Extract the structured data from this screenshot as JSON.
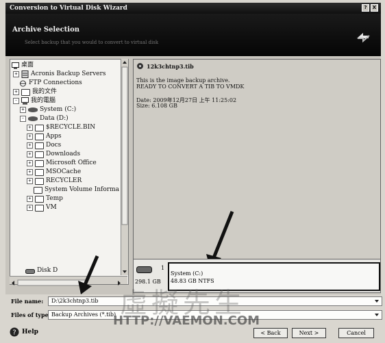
{
  "window": {
    "title": "Conversion to Virtual Disk Wizard",
    "controls": [
      "?",
      "X"
    ]
  },
  "header": {
    "title": "Archive Selection",
    "subtitle": "Select backup that you would to convert to virtual disk"
  },
  "tree": {
    "items": [
      {
        "label": "桌面",
        "icon": "desktop-icon",
        "expander": ""
      },
      {
        "label": "Acronis Backup Servers",
        "icon": "server-icon",
        "expander": "+"
      },
      {
        "label": "FTP Connections",
        "icon": "ftp-icon",
        "expander": ""
      },
      {
        "label": "我的文件",
        "icon": "folder-icon",
        "expander": "+"
      },
      {
        "label": "我的電腦",
        "icon": "computer-icon",
        "expander": "-"
      },
      {
        "label": "System (C:)",
        "icon": "drive-icon",
        "expander": "+"
      },
      {
        "label": "Data (D:)",
        "icon": "drive-icon",
        "expander": "-"
      },
      {
        "label": "$RECYCLE.BIN",
        "icon": "folder-icon",
        "expander": "+"
      },
      {
        "label": "Apps",
        "icon": "folder-icon",
        "expander": "+"
      },
      {
        "label": "Docs",
        "icon": "folder-icon",
        "expander": "+"
      },
      {
        "label": "Downloads",
        "icon": "folder-icon",
        "expander": "+"
      },
      {
        "label": "Microsoft Office",
        "icon": "folder-icon",
        "expander": "+"
      },
      {
        "label": "MSOCache",
        "icon": "folder-icon",
        "expander": "+"
      },
      {
        "label": "RECYCLER",
        "icon": "folder-icon",
        "expander": "+"
      },
      {
        "label": "System Volume Informa",
        "icon": "folder-icon",
        "expander": ""
      },
      {
        "label": "Temp",
        "icon": "folder-icon",
        "expander": "+"
      },
      {
        "label": "VM",
        "icon": "folder-icon",
        "expander": "+"
      }
    ],
    "disk_label": "Disk D"
  },
  "details": {
    "file_title": "12k3chtnp3.tib",
    "desc_line1": "This is the image backup archive.",
    "desc_line2": "READY TO CONVERT A TIB TO VMDK",
    "date_line": "Date: 2009年12月27日 上午 11:25:02",
    "size_line": "Size: 6.108 GB"
  },
  "partition": {
    "disk_num": "1",
    "disk_size": "298.1 GB",
    "name": "System (C:)",
    "info": "48.83 GB  NTFS"
  },
  "fields": {
    "file_name_label": "File name:",
    "file_name_value": "D:\\2k3chtnp3.tib",
    "file_type_label": "Files of type:",
    "file_type_value": "Backup Archives (*.tib)"
  },
  "buttons": {
    "help": "Help",
    "back": "< Back",
    "next": "Next >",
    "cancel": "Cancel"
  },
  "watermark": {
    "text_cn": "虛擬先生",
    "url": "HTTP://VAEMON.COM"
  },
  "colors": {
    "titlebar": "#101010",
    "header_bg": "#0b0b0b",
    "window_bg": "#d9d6cf",
    "details_bg": "#cfccc5"
  }
}
